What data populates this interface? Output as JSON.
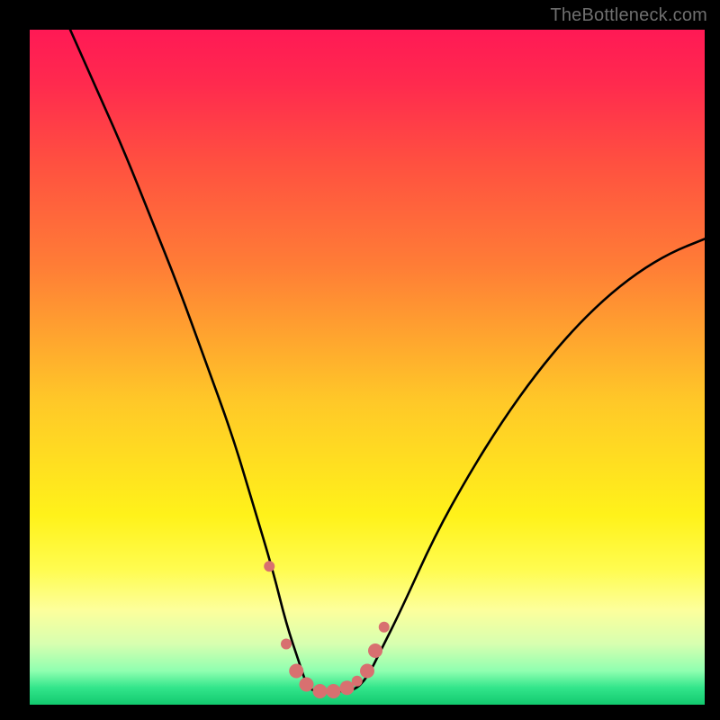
{
  "watermark": "TheBottleneck.com",
  "chart_data": {
    "type": "line",
    "title": "",
    "xlabel": "",
    "ylabel": "",
    "xlim": [
      0,
      100
    ],
    "ylim": [
      0,
      100
    ],
    "series": [
      {
        "name": "bottleneck-curve",
        "x": [
          6.0,
          10,
          14,
          18,
          22,
          26,
          30,
          33,
          36,
          38,
          40,
          41,
          42,
          43,
          45,
          48,
          50,
          52,
          55,
          60,
          65,
          70,
          75,
          80,
          85,
          90,
          95,
          100
        ],
        "y": [
          100,
          91,
          82,
          72,
          62,
          51,
          40,
          30,
          20,
          12,
          6,
          3,
          2,
          2,
          2,
          2,
          4,
          8,
          14,
          25,
          34,
          42,
          49,
          55,
          60,
          64,
          67,
          69
        ]
      }
    ],
    "markers": {
      "name": "highlight-dots",
      "x": [
        35.5,
        38.0,
        39.5,
        41.0,
        43.0,
        45.0,
        47.0,
        48.5,
        50.0,
        51.2,
        52.5
      ],
      "y": [
        20.5,
        9.0,
        5.0,
        3.0,
        2.0,
        2.0,
        2.5,
        3.5,
        5.0,
        8.0,
        11.5
      ],
      "r": [
        6,
        6,
        8,
        8,
        8,
        8,
        8,
        6,
        8,
        8,
        6
      ]
    },
    "gradient_stops": [
      {
        "offset": 0.0,
        "color": "#ff1955"
      },
      {
        "offset": 0.08,
        "color": "#ff2a4e"
      },
      {
        "offset": 0.2,
        "color": "#ff5140"
      },
      {
        "offset": 0.35,
        "color": "#ff7d36"
      },
      {
        "offset": 0.55,
        "color": "#ffc828"
      },
      {
        "offset": 0.72,
        "color": "#fff21a"
      },
      {
        "offset": 0.8,
        "color": "#fffc50"
      },
      {
        "offset": 0.86,
        "color": "#fdff9c"
      },
      {
        "offset": 0.91,
        "color": "#d7ffb0"
      },
      {
        "offset": 0.95,
        "color": "#8fffb0"
      },
      {
        "offset": 0.975,
        "color": "#32e58b"
      },
      {
        "offset": 1.0,
        "color": "#12c96e"
      }
    ],
    "marker_color": "#d87070",
    "curve_color": "#000000"
  }
}
